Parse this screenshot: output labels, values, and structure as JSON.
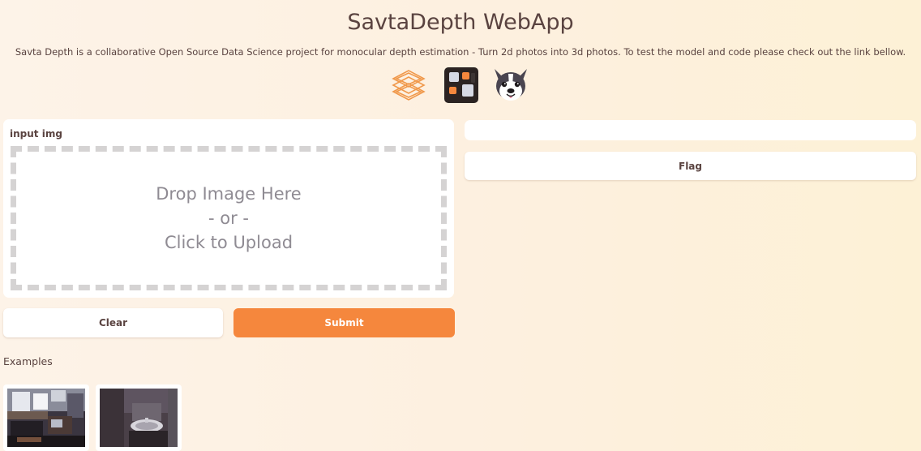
{
  "page": {
    "title": "SavtaDepth WebApp",
    "description": "Savta Depth is a collaborative Open Source Data Science project for monocular depth estimation - Turn 2d photos into 3d photos. To test the model and code please check out the link bellow."
  },
  "logos": [
    "dvc-logo-icon",
    "dagshub-logo-icon",
    "boston-terrier-logo-icon"
  ],
  "input": {
    "label": "input img",
    "dropzone": {
      "line1": "Drop Image Here",
      "line2": "- or -",
      "line3": "Click to Upload"
    }
  },
  "actions": {
    "clear_label": "Clear",
    "submit_label": "Submit",
    "flag_label": "Flag"
  },
  "examples": {
    "label": "Examples",
    "items": [
      "office-room-photo",
      "bathroom-sink-photo"
    ]
  },
  "colors": {
    "accent": "#f5873d",
    "text": "#5a4340",
    "dropzone_border": "#d5d3d3",
    "dropzone_text": "#8f8b93",
    "background_start": "#fdf3e8",
    "background_end": "#fdf1d6"
  }
}
